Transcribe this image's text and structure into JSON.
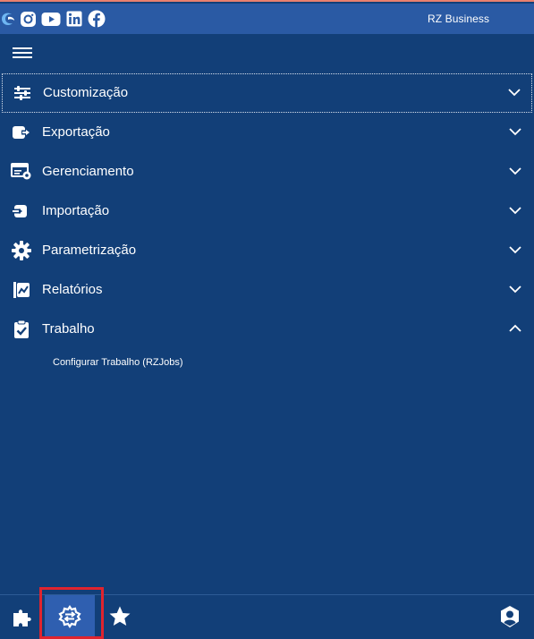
{
  "header": {
    "brand": "RZ Business",
    "social": [
      {
        "icon": "instagram-icon"
      },
      {
        "icon": "youtube-icon"
      },
      {
        "icon": "linkedin-icon"
      },
      {
        "icon": "facebook-icon"
      }
    ]
  },
  "menu": {
    "items": [
      {
        "label": "Customização",
        "icon": "sliders-icon",
        "expanded": false
      },
      {
        "label": "Exportação",
        "icon": "export-icon",
        "expanded": false
      },
      {
        "label": "Gerenciamento",
        "icon": "management-icon",
        "expanded": false
      },
      {
        "label": "Importação",
        "icon": "import-icon",
        "expanded": false
      },
      {
        "label": "Parametrização",
        "icon": "gear-icon",
        "expanded": false
      },
      {
        "label": "Relatórios",
        "icon": "report-chart-icon",
        "expanded": false
      },
      {
        "label": "Trabalho",
        "icon": "clipboard-check-icon",
        "expanded": true
      }
    ],
    "submenu": {
      "label": "Configurar Trabalho (RZJobs)"
    }
  },
  "bottombar": {
    "buttons": [
      {
        "icon": "puzzle-icon",
        "active": false
      },
      {
        "icon": "settings-swap-icon",
        "active": true
      },
      {
        "icon": "star-icon",
        "active": false
      },
      {
        "icon": "user-shield-icon",
        "active": false
      }
    ]
  },
  "colors": {
    "background": "#123f78",
    "topbar": "#2a5aa4",
    "active_button": "#2f5fb0",
    "highlight": "#e0242e",
    "text": "#ffffff"
  }
}
